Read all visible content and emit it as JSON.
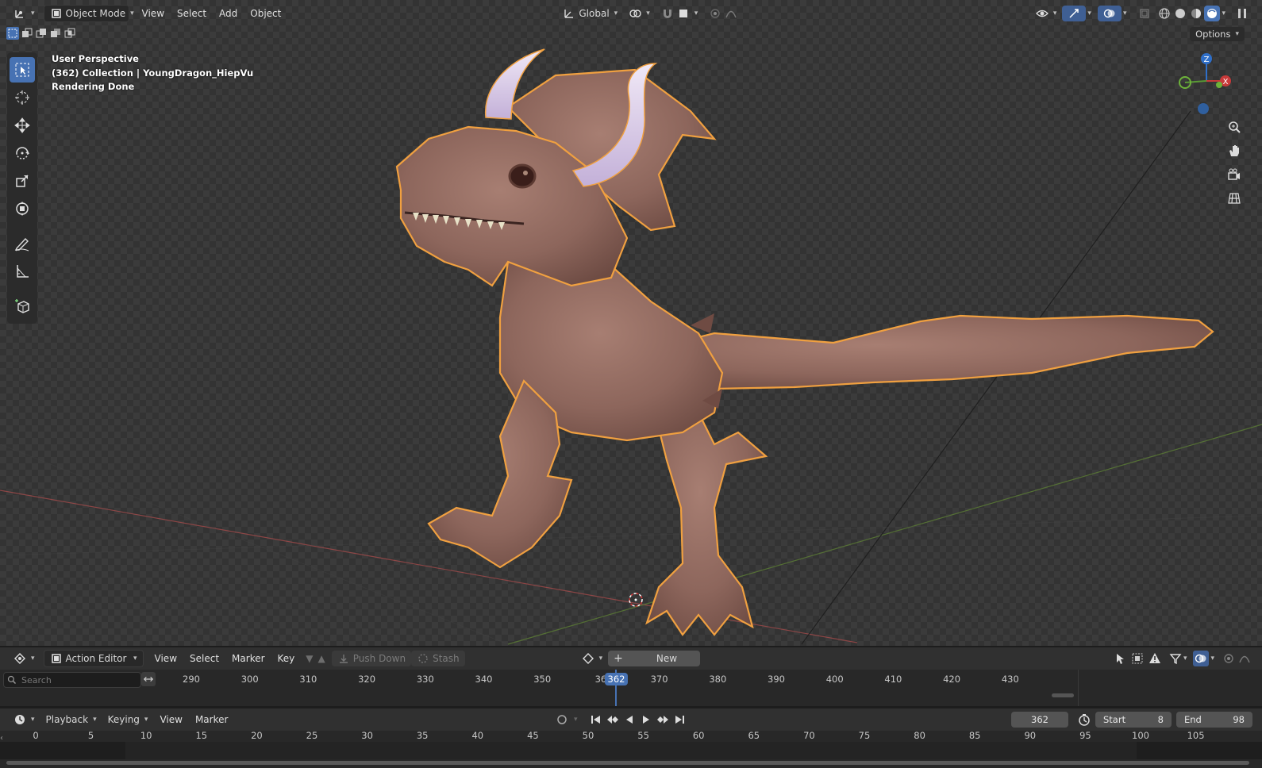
{
  "header": {
    "mode": "Object Mode",
    "menus": [
      "View",
      "Select",
      "Add",
      "Object"
    ],
    "transform_orientation": "Global",
    "options_label": "Options"
  },
  "viewport": {
    "perspective_label": "User Perspective",
    "collection_label": "(362) Collection | YoungDragon_HiepVu",
    "status_label": "Rendering Done",
    "gizmo": {
      "x_label": "X",
      "z_label": "Z"
    },
    "object_outline_color": "#f0a040",
    "active_tool_color": "#4772b3"
  },
  "toolbox": {
    "tools": [
      "select-box-icon",
      "cursor-icon",
      "move-icon",
      "rotate-icon",
      "scale-icon",
      "transform-icon",
      "annotate-icon",
      "measure-icon",
      "add-cube-icon"
    ]
  },
  "action_editor": {
    "editor_type": "Action Editor",
    "menus": [
      "View",
      "Select",
      "Marker",
      "Key"
    ],
    "push_down_label": "Push Down",
    "stash_label": "Stash",
    "new_label": "New",
    "search_placeholder": "Search",
    "ruler_ticks": [
      "290",
      "300",
      "310",
      "320",
      "330",
      "340",
      "350",
      "36",
      "370",
      "380",
      "390",
      "400",
      "410",
      "420",
      "430"
    ],
    "current_frame_badge": "362"
  },
  "timeline": {
    "menus": [
      "Playback",
      "Keying",
      "View",
      "Marker"
    ],
    "current_frame": "362",
    "start_label": "Start",
    "start_value": "8",
    "end_label": "End",
    "end_value": "98",
    "ruler_ticks": [
      "0",
      "5",
      "10",
      "15",
      "20",
      "25",
      "30",
      "35",
      "40",
      "45",
      "50",
      "55",
      "60",
      "65",
      "70",
      "75",
      "80",
      "85",
      "90",
      "95",
      "100",
      "105"
    ]
  }
}
